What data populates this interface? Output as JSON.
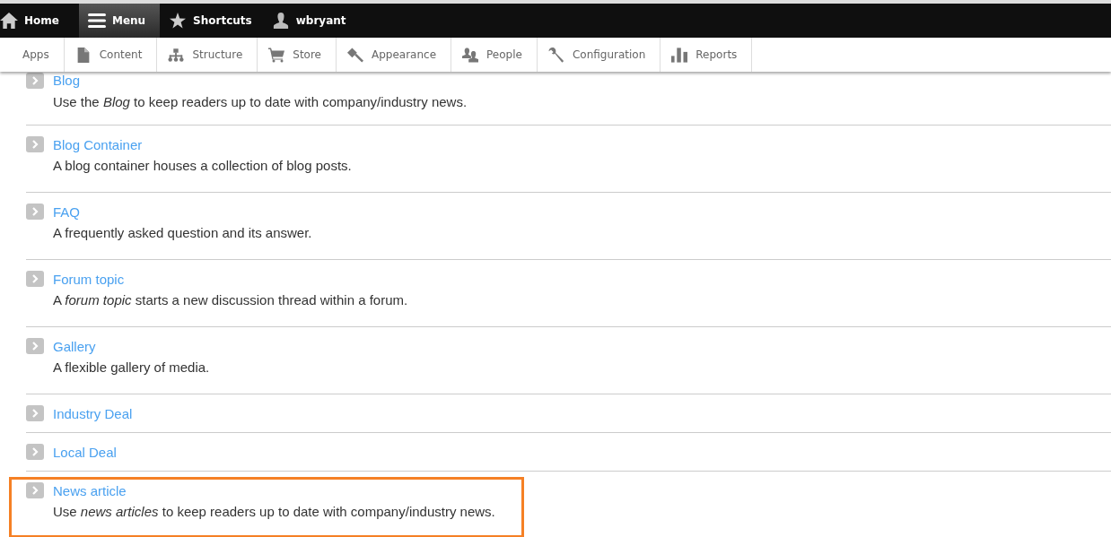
{
  "toolbar": {
    "items": [
      {
        "label": "Home",
        "selected": false
      },
      {
        "label": "Menu",
        "selected": true
      },
      {
        "label": "Shortcuts",
        "selected": false
      },
      {
        "label": "wbryant",
        "selected": false
      }
    ]
  },
  "tray": {
    "items": [
      {
        "label": "Apps"
      },
      {
        "label": "Content"
      },
      {
        "label": "Structure"
      },
      {
        "label": "Store"
      },
      {
        "label": "Appearance"
      },
      {
        "label": "People"
      },
      {
        "label": "Configuration"
      },
      {
        "label": "Reports"
      }
    ]
  },
  "content_types": [
    {
      "title": "Blog",
      "description": "Use the *Blog* to keep readers up to date with company/industry news.",
      "highlighted": false
    },
    {
      "title": "Blog Container",
      "description": "A blog container houses a collection of blog posts.",
      "highlighted": false
    },
    {
      "title": "FAQ",
      "description": "A frequently asked question and its answer.",
      "highlighted": false
    },
    {
      "title": "Forum topic",
      "description": "A *forum topic* starts a new discussion thread within a forum.",
      "highlighted": false
    },
    {
      "title": "Gallery",
      "description": "A flexible gallery of media.",
      "highlighted": false
    },
    {
      "title": "Industry Deal",
      "highlighted": false
    },
    {
      "title": "Local Deal",
      "highlighted": false
    },
    {
      "title": "News article",
      "description": "Use *news articles* to keep readers up to date with company/industry news.",
      "highlighted": true
    }
  ]
}
